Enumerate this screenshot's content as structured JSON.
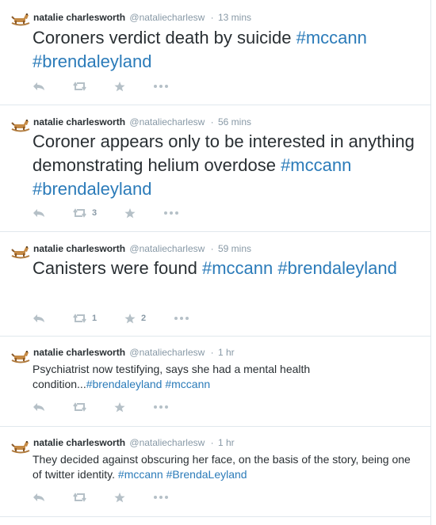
{
  "tweets": [
    {
      "fullname": "natalie charlesworth",
      "username": "@nataliecharlesw",
      "separator": "·",
      "time": "13 mins",
      "text_plain": "Coroners verdict death by suicide  ",
      "hashtag1": "#mccann",
      "hashtag2": "#brendaleyland",
      "retweet_count": "",
      "favorite_count": ""
    },
    {
      "fullname": "natalie charlesworth",
      "username": "@nataliecharlesw",
      "separator": "·",
      "time": "56 mins",
      "text_plain": "Coroner appears only to be interested in anything demonstrating helium overdose ",
      "hashtag1": "#mccann",
      "hashtag2": "#brendaleyland",
      "retweet_count": "3",
      "favorite_count": ""
    },
    {
      "fullname": "natalie charlesworth",
      "username": "@nataliecharlesw",
      "separator": "·",
      "time": "59 mins",
      "text_plain": "Canisters were found ",
      "hashtag1": "#mccann",
      "hashtag2": "#brendaleyland",
      "retweet_count": "1",
      "favorite_count": "2"
    },
    {
      "fullname": "natalie charlesworth",
      "username": "@nataliecharlesw",
      "separator": "·",
      "time": "1 hr",
      "text_plain": "Psychiatrist now testifying, says she had a mental health condition...",
      "hashtag1": "#brendaleyland",
      "hashtag2": "#mccann",
      "retweet_count": "",
      "favorite_count": ""
    },
    {
      "fullname": "natalie charlesworth",
      "username": "@nataliecharlesw",
      "separator": "·",
      "time": "1 hr",
      "text_plain": "They decided against obscuring her face, on the basis of the story, being one of twitter identity. ",
      "hashtag1": "#mccann",
      "hashtag2": "#BrendaLeyland",
      "retweet_count": "",
      "favorite_count": ""
    }
  ],
  "icons": {
    "avatar": "rocking-horse-avatar",
    "reply": "reply-icon",
    "retweet": "retweet-icon",
    "favorite": "star-icon",
    "more": "more-dots-icon"
  },
  "colors": {
    "hashtag": "#2b7bb9",
    "muted": "#8899a6",
    "icon": "#b5c0c7",
    "border": "#e1e8ed",
    "text": "#292f33"
  }
}
